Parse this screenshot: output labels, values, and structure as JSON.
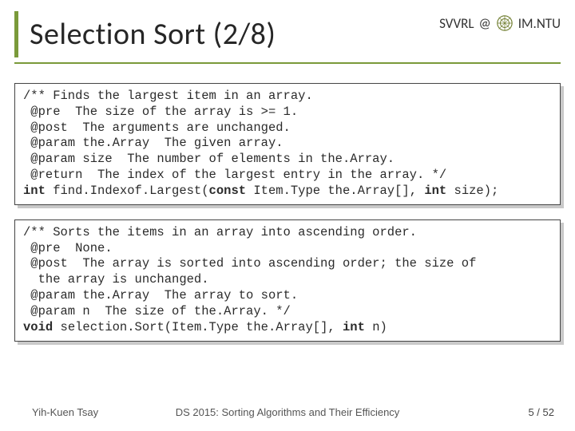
{
  "header": {
    "title": "Selection Sort (2/8)",
    "right_text_1": "SVVRL",
    "at": "@",
    "right_text_2": "IM.NTU"
  },
  "blocks": {
    "first": {
      "l1": "/** Finds the largest item in an array.",
      "l2": " @pre  The size of the array is >= 1.",
      "l3": " @post  The arguments are unchanged.",
      "l4": " @param the.Array  The given array.",
      "l5": " @param size  The number of elements in the.Array.",
      "l6": " @return  The index of the largest entry in the array. */",
      "l7a": "int",
      "l7b": " find.Indexof.Largest(",
      "l7c": "const",
      "l7d": " Item.Type the.Array[], ",
      "l7e": "int",
      "l7f": " size);"
    },
    "second": {
      "l1": "/** Sorts the items in an array into ascending order.",
      "l2": " @pre  None.",
      "l3": " @post  The array is sorted into ascending order; the size of",
      "l4": "  the array is unchanged.",
      "l5": " @param the.Array  The array to sort.",
      "l6": " @param n  The size of the.Array. */",
      "l7a": "void",
      "l7b": " selection.Sort(Item.Type the.Array[], ",
      "l7c": "int",
      "l7d": " n)"
    }
  },
  "footer": {
    "left": "Yih-Kuen Tsay",
    "center": "DS 2015: Sorting Algorithms and Their Efficiency",
    "right": "5 / 52"
  }
}
